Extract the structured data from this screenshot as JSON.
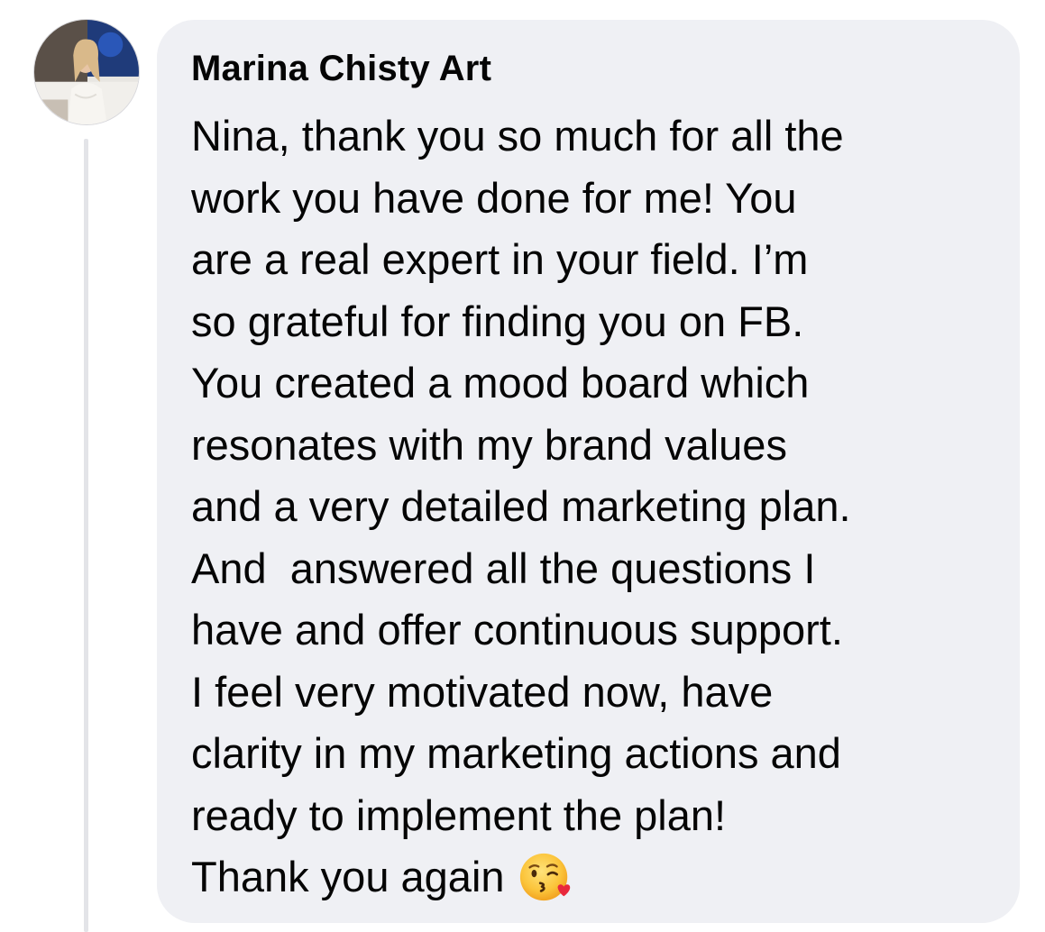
{
  "comment": {
    "author": "Marina Chisty Art",
    "lines": [
      "Nina, thank you so much for all the",
      "work you have done for me! You",
      "are a real expert in your field. I’m",
      "so grateful for finding you on FB.",
      "You created a mood board which",
      "resonates with my brand values",
      "and a very detailed marketing plan.",
      "And  answered all the questions I",
      "have and offer continuous support.",
      "I feel very motivated now, have",
      "clarity in my marketing actions and",
      "ready to implement the plan!",
      "Thank you again"
    ],
    "trailing_emoji": "face-blowing-a-kiss-icon"
  },
  "colors": {
    "bubble_background": "#eff0f4",
    "text": "#050505",
    "thread_line": "#e3e4e8"
  }
}
